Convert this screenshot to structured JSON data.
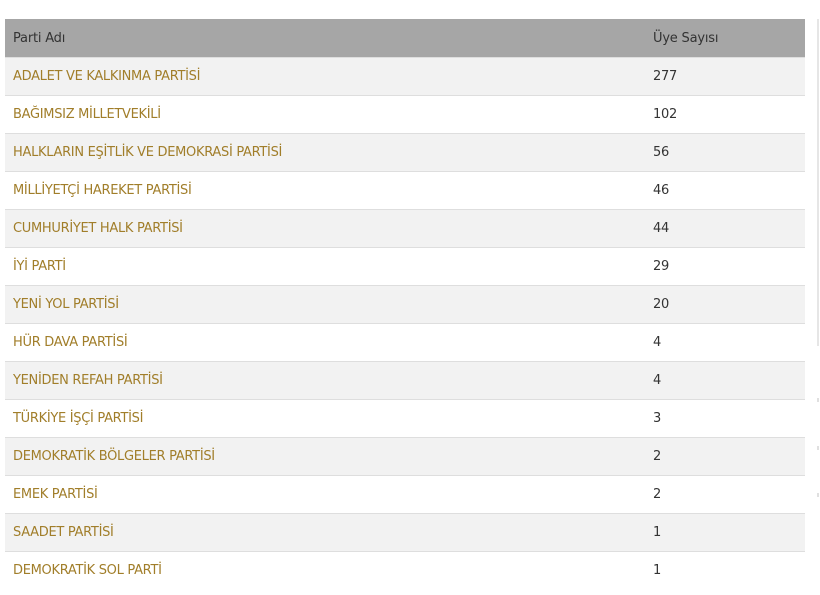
{
  "table": {
    "headers": {
      "party": "Parti Adı",
      "count": "Üye Sayısı"
    },
    "rows": [
      {
        "party": "ADALET VE KALKINMA PARTİSİ",
        "count": "277"
      },
      {
        "party": "BAĞIMSIZ MİLLETVEKİLİ",
        "count": "102"
      },
      {
        "party": "HALKLARIN EŞİTLİK VE DEMOKRASİ PARTİSİ",
        "count": "56"
      },
      {
        "party": "MİLLİYETÇİ HAREKET PARTİSİ",
        "count": "46"
      },
      {
        "party": "CUMHURİYET HALK PARTİSİ",
        "count": "44"
      },
      {
        "party": "İYİ PARTİ",
        "count": "29"
      },
      {
        "party": "YENİ YOL PARTİSİ",
        "count": "20"
      },
      {
        "party": "HÜR DAVA PARTİSİ",
        "count": "4"
      },
      {
        "party": "YENİDEN REFAH PARTİSİ",
        "count": "4"
      },
      {
        "party": "TÜRKİYE İŞÇİ PARTİSİ",
        "count": "3"
      },
      {
        "party": "DEMOKRATİK BÖLGELER PARTİSİ",
        "count": "2"
      },
      {
        "party": "EMEK PARTİSİ",
        "count": "2"
      },
      {
        "party": "SAADET PARTİSİ",
        "count": "1"
      },
      {
        "party": "DEMOKRATİK SOL PARTİ",
        "count": "1"
      }
    ]
  },
  "colors": {
    "header_bg": "#a6a6a6",
    "link": "#a17e2a",
    "stripe": "#f2f2f2"
  }
}
